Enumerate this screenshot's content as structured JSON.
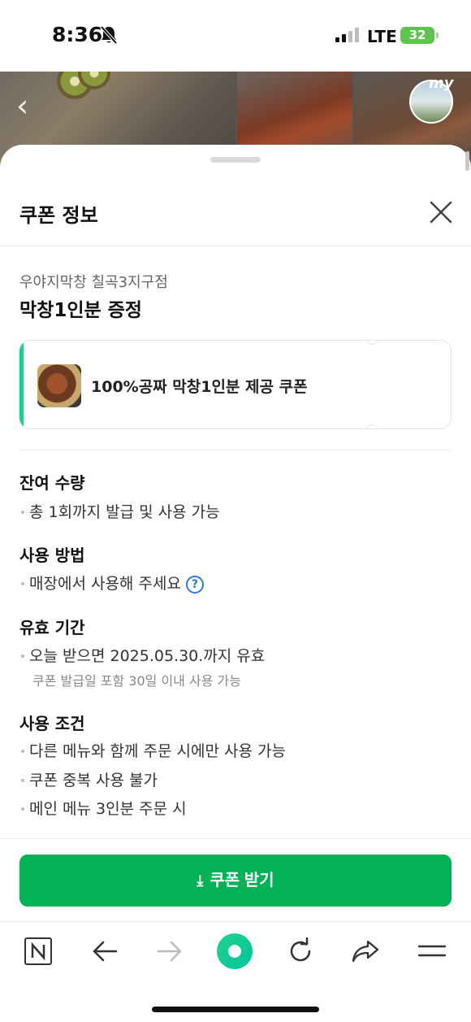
{
  "status_bar": {
    "time": "8:36",
    "network": "LTE",
    "battery": "32"
  },
  "header_overlay": {
    "profile_label": "my"
  },
  "sheet": {
    "title": "쿠폰 정보",
    "store_name": "우야지막창 칠곡3지구점",
    "coupon_name": "막창1인분 증정",
    "ticket_text": "100%공짜 막창1인분 제공 쿠폰",
    "sections": {
      "quantity": {
        "title": "잔여 수량",
        "items": [
          "총 1회까지 발급 및 사용 가능"
        ]
      },
      "method": {
        "title": "사용 방법",
        "items": [
          "매장에서 사용해 주세요"
        ]
      },
      "validity": {
        "title": "유효 기간",
        "items": [
          "오늘 받으면 2025.05.30.까지 유효"
        ],
        "note": "쿠폰 발급일 포함 30일 이내 사용 가능"
      },
      "conditions": {
        "title": "사용 조건",
        "items": [
          "다른 메뉴와 함께 주문 시에만 사용 가능",
          "쿠폰 중복 사용 불가",
          "메인 메뉴 3인분 주문 시"
        ]
      }
    },
    "cta_label": "쿠폰 받기"
  },
  "colors": {
    "accent": "#03b157",
    "ticket_bar": "#1fcf8a",
    "help": "#2b7cd6"
  },
  "navbar": {
    "icons": [
      "naver-n-icon",
      "back-arrow-icon",
      "forward-arrow-icon",
      "green-dot-icon",
      "refresh-icon",
      "share-icon",
      "menu-icon"
    ]
  }
}
